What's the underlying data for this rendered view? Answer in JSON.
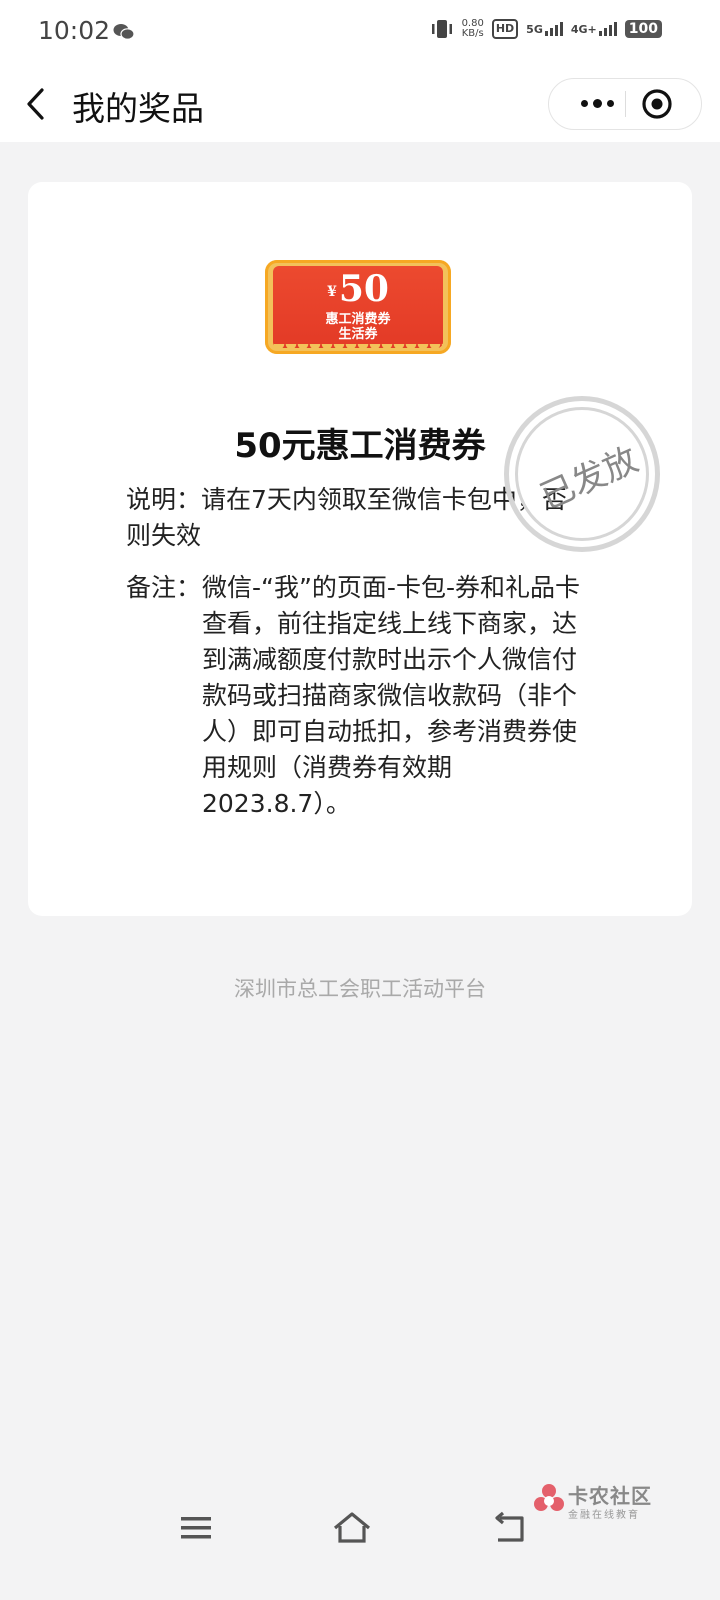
{
  "status_bar": {
    "time": "10:02",
    "net_speed_value": "0.80",
    "net_speed_unit": "KB/s",
    "hd_label": "HD",
    "signal_1": "5G",
    "signal_2": "4G+",
    "battery": "100"
  },
  "header": {
    "title": "我的奖品"
  },
  "coupon_image": {
    "currency": "¥",
    "amount": "50",
    "line1": "惠工消费券",
    "line2": "生活券"
  },
  "prize": {
    "title": "50元惠工消费券",
    "stamp": "已发放",
    "desc_label": "说明：",
    "desc_text": "请在7天内领取至微信卡包中，否则失效",
    "note_label": "备注：",
    "note_text": "微信-“我”的页面-卡包-券和礼品卡查看，前往指定线上线下商家，达到满减额度付款时出示个人微信付款码或扫描商家微信收款码（非个人）即可自动抵扣，参考消费券使用规则（消费券有效期2023.8.7）。"
  },
  "footer": {
    "org": "深圳市总工会职工活动平台"
  },
  "watermark": {
    "name": "卡农社区",
    "sub": "金融在线教育"
  },
  "colors": {
    "accent_red": "#e33a26",
    "coupon_gold": "#f6a823",
    "stamp_gray": "#d6d6d6"
  }
}
